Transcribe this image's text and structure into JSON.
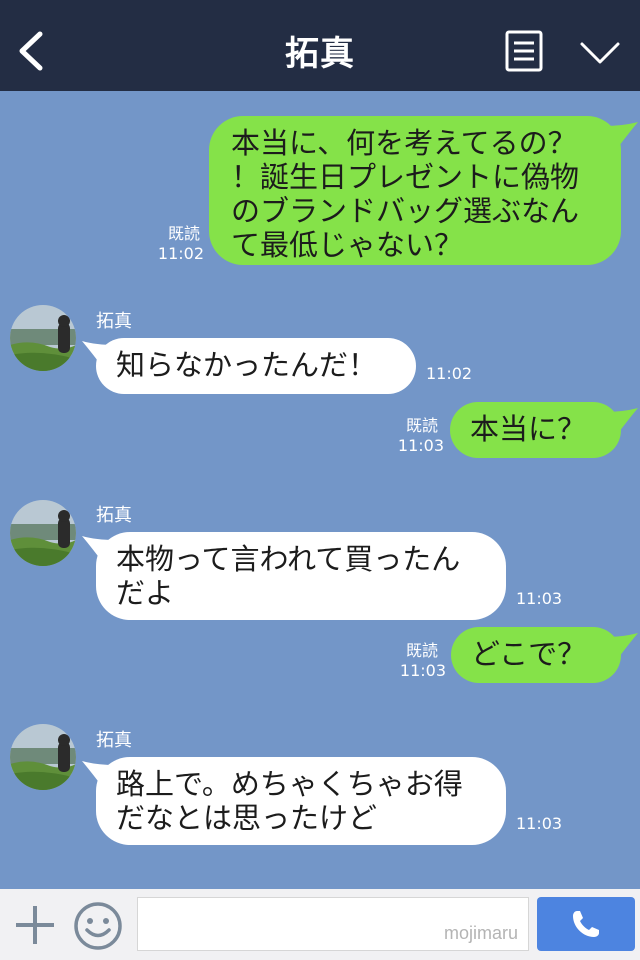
{
  "header": {
    "title": "拓真",
    "back_icon": "chevron-left-icon",
    "menu_icon": "list-icon",
    "collapse_icon": "chevron-down-icon"
  },
  "messages": [
    {
      "direction": "out",
      "text": "本当に、何を考えてるの？\n！誕生日プレゼントに偽物\nのブランドバッグ選ぶなん\nて最低じゃない？",
      "read": "既読",
      "time": "11:02"
    },
    {
      "direction": "in",
      "sender": "拓真",
      "text": "知らなかったんだ！",
      "time": "11:02"
    },
    {
      "direction": "out",
      "text": "本当に？",
      "read": "既読",
      "time": "11:03"
    },
    {
      "direction": "in",
      "sender": "拓真",
      "text": "本物って言われて買ったん\nだよ",
      "time": "11:03"
    },
    {
      "direction": "out",
      "text": "どこで？",
      "read": "既読",
      "time": "11:03"
    },
    {
      "direction": "in",
      "sender": "拓真",
      "text": "路上で。めちゃくちゃお得\nだなとは思ったけど",
      "time": "11:03"
    }
  ],
  "input_bar": {
    "watermark": "mojimaru",
    "plus_icon": "plus-icon",
    "emoji_icon": "smiley-icon",
    "call_icon": "phone-icon"
  },
  "colors": {
    "header_bg": "#232d44",
    "chat_bg": "#7396c8",
    "outgoing_bubble": "#85e249",
    "incoming_bubble": "#ffffff",
    "call_button": "#4d84e0"
  }
}
